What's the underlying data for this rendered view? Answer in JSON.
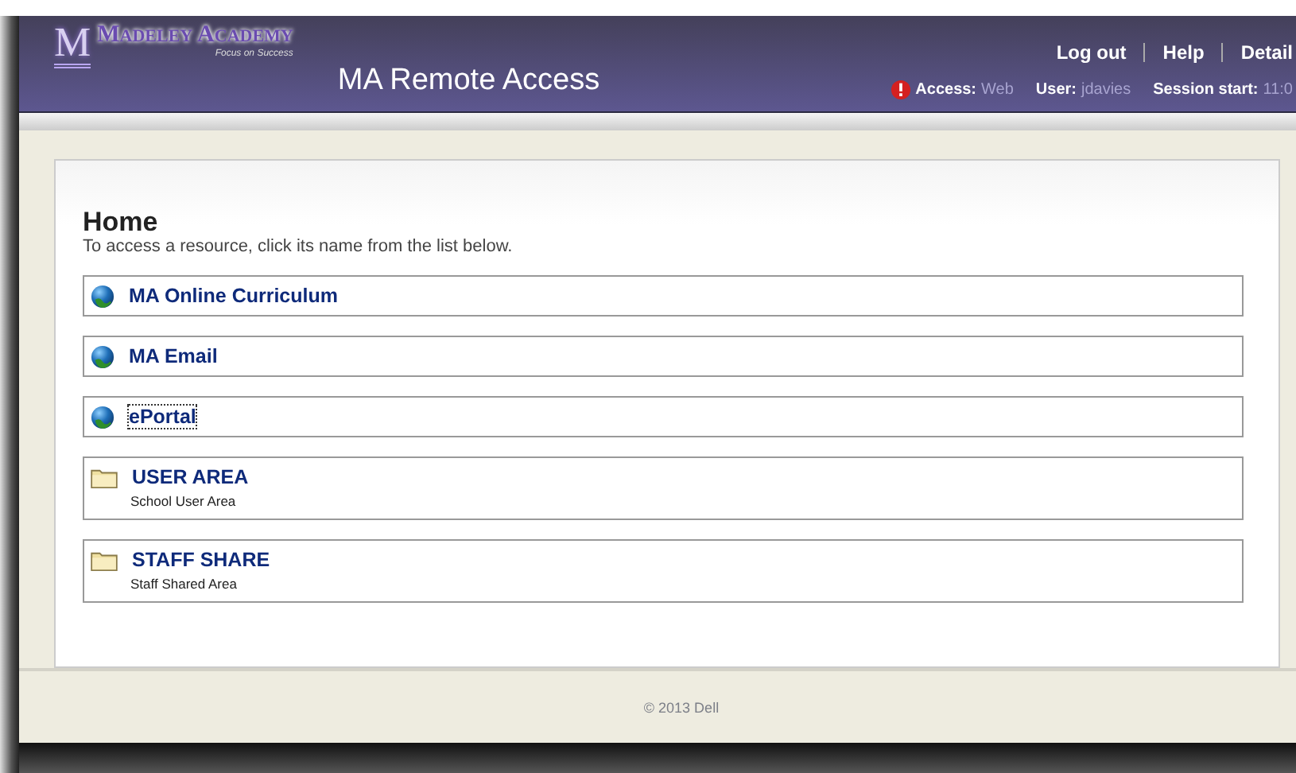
{
  "header": {
    "logo_letter": "M",
    "logo_name": "Madeley Academy",
    "logo_tagline": "Focus on Success",
    "title": "MA Remote Access",
    "links": [
      "Log out",
      "Help",
      "Detail"
    ],
    "status": [
      {
        "label": "Access:",
        "value": "Web",
        "alert": true
      },
      {
        "label": "User:",
        "value": "jdavies",
        "alert": false
      },
      {
        "label": "Session start:",
        "value": "11:0",
        "alert": false
      }
    ]
  },
  "page": {
    "heading": "Home",
    "intro": "To access a resource, click its name from the list below."
  },
  "resources": [
    {
      "kind": "web",
      "name": "MA Online Curriculum",
      "focused": false
    },
    {
      "kind": "web",
      "name": "MA Email",
      "focused": false
    },
    {
      "kind": "web",
      "name": "ePortal",
      "focused": true
    },
    {
      "kind": "folder",
      "name": "USER AREA",
      "description": "School User Area",
      "focused": false
    },
    {
      "kind": "folder",
      "name": "STAFF SHARE",
      "description": "Staff Shared Area",
      "focused": false
    }
  ],
  "footer": "© 2013 Dell"
}
